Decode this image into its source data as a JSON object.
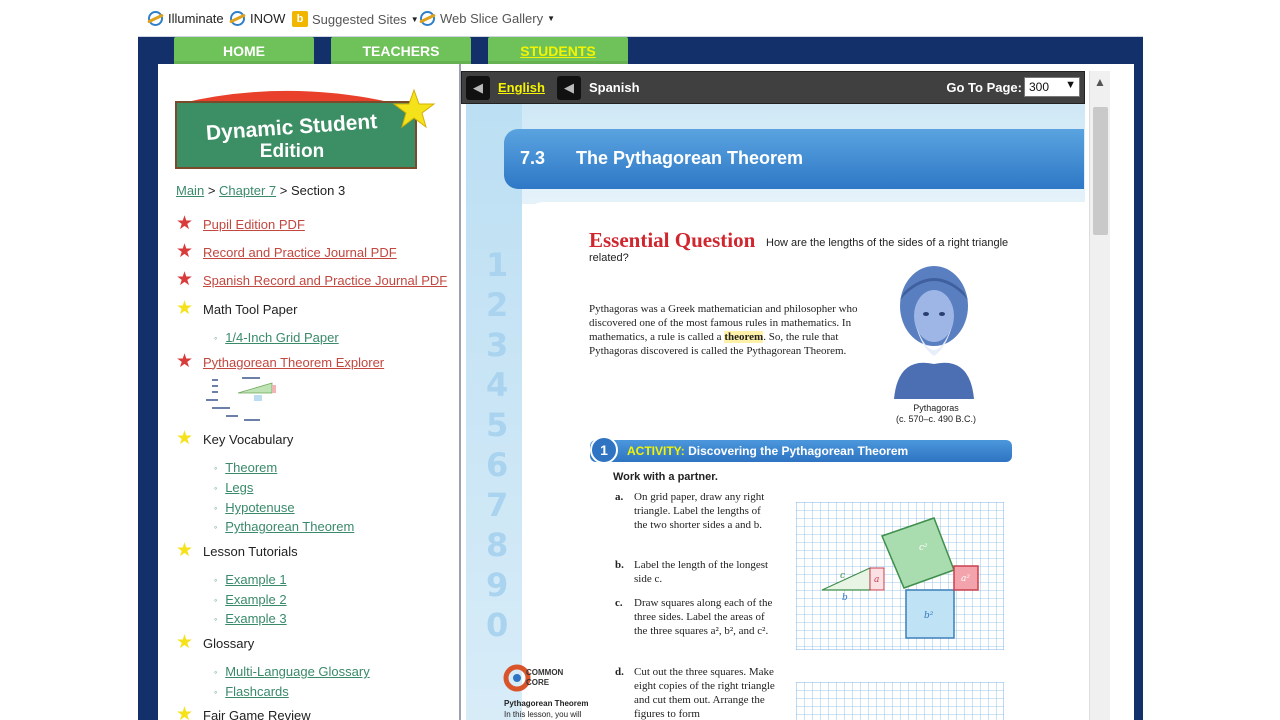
{
  "favorites": {
    "items": [
      {
        "label": "Illuminate"
      },
      {
        "label": "INOW"
      },
      {
        "label": "Suggested Sites"
      },
      {
        "label": "Web Slice Gallery"
      }
    ]
  },
  "nav": {
    "tabs": [
      {
        "label": "HOME"
      },
      {
        "label": "TEACHERS"
      },
      {
        "label": "STUDENTS"
      }
    ]
  },
  "logo": {
    "line1": "Dynamic Student",
    "line2": "Edition"
  },
  "breadcrumb": {
    "main": "Main",
    "sep1": ">",
    "chapter": "Chapter 7",
    "sep2": ">",
    "section": "Section 3"
  },
  "sidebar": {
    "items": [
      {
        "label": "Pupil Edition PDF"
      },
      {
        "label": "Record and Practice Journal PDF"
      },
      {
        "label": "Spanish Record and Practice Journal PDF"
      },
      {
        "label": "Math Tool Paper"
      },
      {
        "label": "Pythagorean Theorem Explorer"
      },
      {
        "label": "Key Vocabulary"
      },
      {
        "label": "Lesson Tutorials"
      },
      {
        "label": "Glossary"
      },
      {
        "label": "Fair Game Review"
      }
    ],
    "sub_grid": [
      {
        "label": "1/4-Inch Grid Paper"
      }
    ],
    "sub_vocab": [
      {
        "label": "Theorem"
      },
      {
        "label": "Legs"
      },
      {
        "label": "Hypotenuse"
      },
      {
        "label": "Pythagorean Theorem"
      }
    ],
    "sub_tutorials": [
      {
        "label": "Example 1"
      },
      {
        "label": "Example 2"
      },
      {
        "label": "Example 3"
      }
    ],
    "sub_glossary": [
      {
        "label": "Multi-Language Glossary"
      },
      {
        "label": "Flashcards"
      }
    ]
  },
  "toolbar": {
    "english_label": "English",
    "spanish_label": "Spanish",
    "goto_label": "Go To Page:",
    "goto_value": "300"
  },
  "page": {
    "section_number": "7.3",
    "section_title": "The Pythagorean Theorem",
    "eq_title": "Essential Question",
    "eq_text": "How are the lengths of the sides of a right triangle related?",
    "para_before": "Pythagoras was a Greek mathematician and philosopher who discovered one of the most famous rules in mathematics. In mathematics, a rule is called a ",
    "para_highlight": "theorem",
    "para_after": ". So, the rule that Pythagoras discovered is called the Pythagorean Theorem.",
    "bust_caption_1": "Pythagoras",
    "bust_caption_2": "(c. 570–c. 490 B.C.)",
    "activity_number": "1",
    "activity_keyword": "ACTIVITY:",
    "activity_title": "Discovering the Pythagorean Theorem",
    "work_with_partner": "Work with a partner.",
    "steps": [
      {
        "letter": "a.",
        "text": "On grid paper, draw any right triangle. Label the lengths of the two shorter sides a and b."
      },
      {
        "letter": "b.",
        "text": "Label the length of the longest side c."
      },
      {
        "letter": "c.",
        "text": "Draw squares along each of the three sides. Label the areas of the three squares a², b², and c²."
      },
      {
        "letter": "d.",
        "text": "Cut out the three squares. Make eight copies of the right triangle and cut them out. Arrange the figures to form"
      }
    ],
    "common_core_1": "COMMON",
    "common_core_2": "CORE",
    "cc_topic": "Pythagorean Theorem",
    "cc_sub": "In this lesson, you will",
    "side_numbers": [
      "1",
      "2",
      "3",
      "4",
      "5",
      "6",
      "7",
      "8",
      "9",
      "0"
    ],
    "figure_labels": {
      "a": "a",
      "b": "b",
      "c": "c",
      "a2": "a²",
      "b2": "b²",
      "c2": "c²"
    }
  }
}
